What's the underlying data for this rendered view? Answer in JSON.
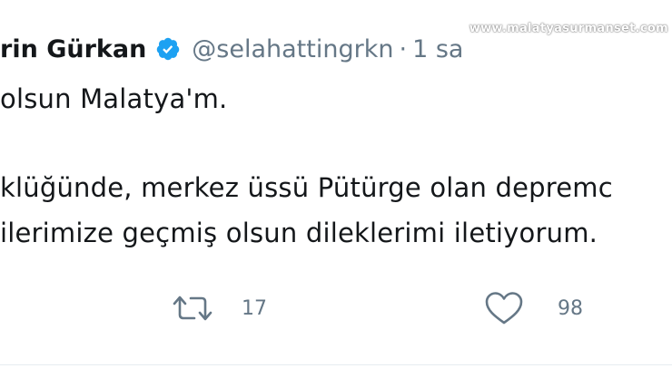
{
  "tweet": {
    "display_name": "rin Gürkan",
    "handle": "@selahattingrkn",
    "separator": "·",
    "time": "1 sa",
    "watermark": "www.malatyasurmanset.com",
    "lines": [
      "olsun Malatya'm.",
      "klüğünde, merkez üssü Pütürge olan depremc",
      "ilerimize geçmiş olsun dileklerimi iletiyorum."
    ],
    "retweet_count": "17",
    "like_count": "98"
  },
  "icons": {
    "verified": "verified-badge-icon",
    "retweet": "retweet-icon",
    "like": "heart-icon"
  },
  "colors": {
    "verified_blue": "#1da1f2",
    "secondary_text": "#657786",
    "primary_text": "#14171a"
  }
}
